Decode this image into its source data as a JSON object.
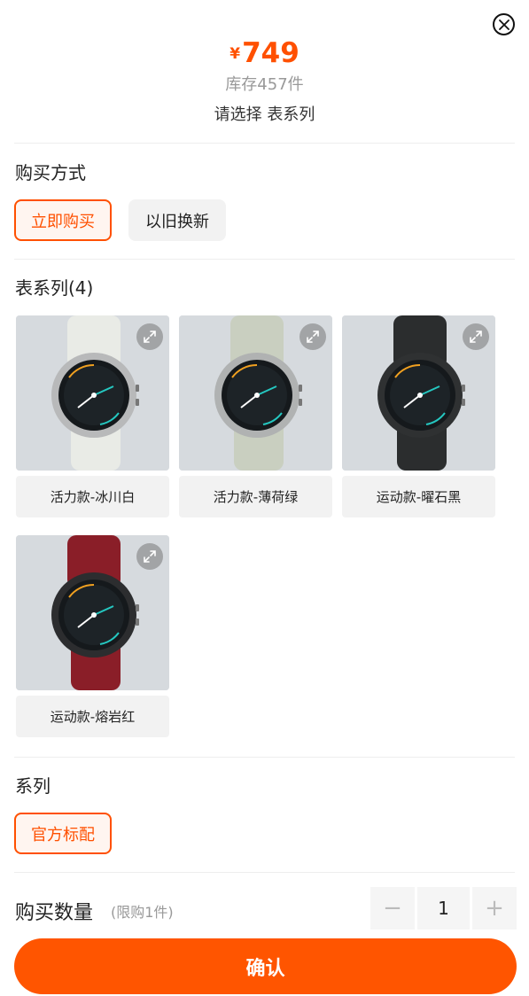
{
  "header": {
    "currency": "¥",
    "price": "749",
    "stock": "库存457件",
    "choose_hint": "请选择 表系列"
  },
  "purchase_method": {
    "title": "购买方式",
    "options": [
      {
        "label": "立即购买",
        "selected": true
      },
      {
        "label": "以旧换新",
        "selected": false
      }
    ]
  },
  "watch_series": {
    "title": "表系列(4)",
    "items": [
      {
        "label": "活力款-冰川白",
        "strap_color": "#e9ebe6",
        "case_color": "#b8b9ba"
      },
      {
        "label": "活力款-薄荷绿",
        "strap_color": "#c9cfc0",
        "case_color": "#b0b2b2"
      },
      {
        "label": "运动款-曜石黑",
        "strap_color": "#2b2d2e",
        "case_color": "#2f3132"
      },
      {
        "label": "运动款-熔岩红",
        "strap_color": "#8a1e28",
        "case_color": "#2c2d2f"
      }
    ]
  },
  "series": {
    "title": "系列",
    "options": [
      {
        "label": "官方标配",
        "selected": true
      }
    ]
  },
  "quantity": {
    "title": "购买数量",
    "limit": "(限购1件)",
    "value": "1",
    "minus": "−",
    "plus": "+"
  },
  "confirm_label": "确认",
  "colors": {
    "accent": "#ff5000",
    "confirm_bg": "#ff5500"
  }
}
